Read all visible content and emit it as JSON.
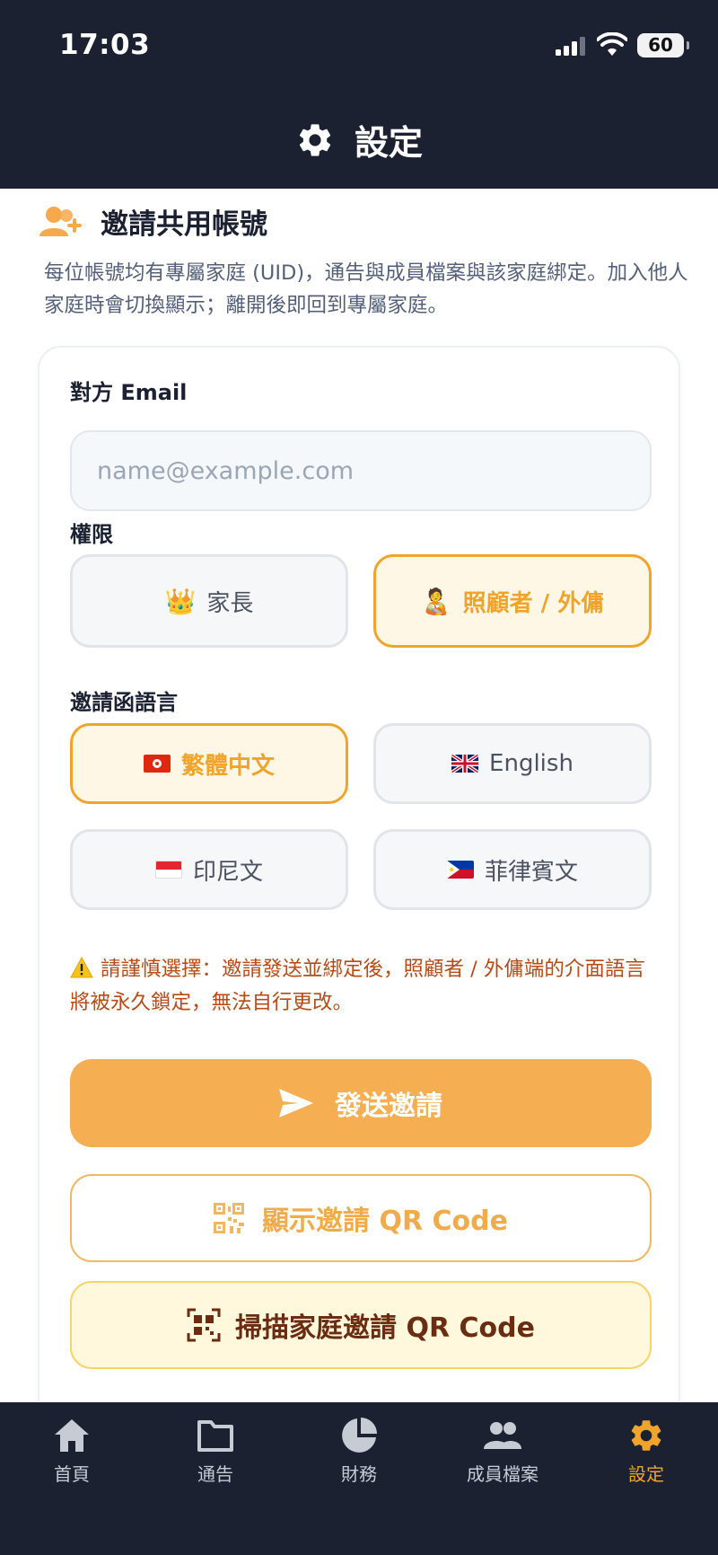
{
  "status": {
    "time": "17:03",
    "battery": "60"
  },
  "header": {
    "title": "設定",
    "icon": "gear-icon"
  },
  "invite": {
    "title": "邀請共用帳號",
    "description": "每位帳號均有專屬家庭 (UID)，通告與成員檔案與該家庭綁定。加入他人家庭時會切換顯示；離開後即回到專屬家庭。",
    "email_label": "對方 Email",
    "email_placeholder": "name@example.com",
    "email_value": "",
    "role_label": "權限",
    "roles": [
      {
        "label": "家長",
        "emoji": "👑",
        "selected": false
      },
      {
        "label": "照顧者 / 外傭",
        "emoji": "🧑‍🍼",
        "selected": true
      }
    ],
    "language_label": "邀請函語言",
    "languages": [
      {
        "label": "繁體中文",
        "flag": "hk-flag",
        "selected": true
      },
      {
        "label": "English",
        "flag": "uk-flag",
        "selected": false
      },
      {
        "label": "印尼文",
        "flag": "id-flag",
        "selected": false
      },
      {
        "label": "菲律賓文",
        "flag": "ph-flag",
        "selected": false
      }
    ],
    "warning": "請謹慎選擇：邀請發送並綁定後，照顧者 / 外傭端的介面語言將被永久鎖定，無法自行更改。",
    "send_button": "發送邀請",
    "show_qr_button": "顯示邀請 QR Code",
    "scan_qr_button": "掃描家庭邀請 QR Code"
  },
  "colors": {
    "accent": "#f0a42b",
    "dark": "#1b2131",
    "warning": "#b84a16"
  },
  "tabs": [
    {
      "label": "首頁",
      "icon": "home-icon",
      "active": false
    },
    {
      "label": "通告",
      "icon": "folder-icon",
      "active": false
    },
    {
      "label": "財務",
      "icon": "pie-chart-icon",
      "active": false
    },
    {
      "label": "成員檔案",
      "icon": "people-icon",
      "active": false
    },
    {
      "label": "設定",
      "icon": "gear-icon",
      "active": true
    }
  ]
}
